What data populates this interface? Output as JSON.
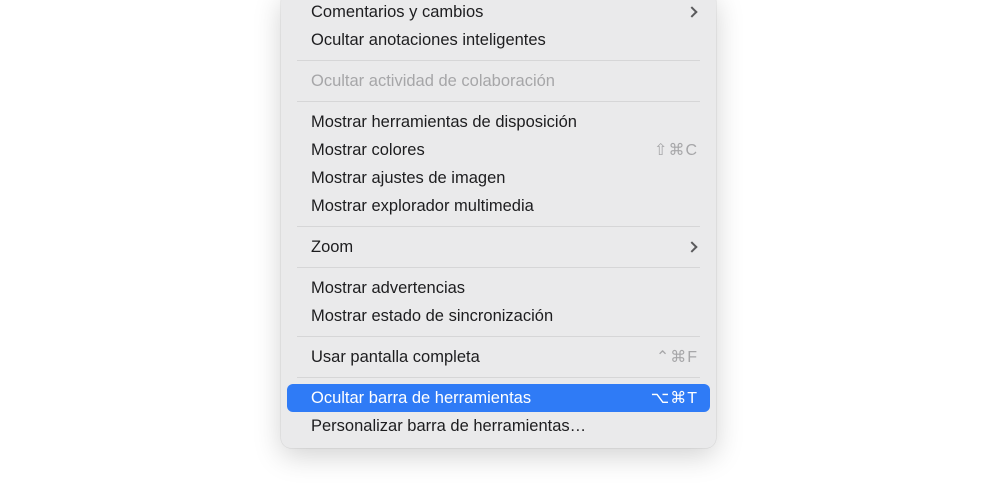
{
  "menu": {
    "items": [
      {
        "label": "Comentarios y cambios",
        "submenu": true
      },
      {
        "label": "Ocultar anotaciones inteligentes"
      },
      {
        "label": "Ocultar actividad de colaboración",
        "disabled": true
      },
      {
        "label": "Mostrar herramientas de disposición"
      },
      {
        "label": "Mostrar colores",
        "shortcut": "⇧⌘C"
      },
      {
        "label": "Mostrar ajustes de imagen"
      },
      {
        "label": "Mostrar explorador multimedia"
      },
      {
        "label": "Zoom",
        "submenu": true
      },
      {
        "label": "Mostrar advertencias"
      },
      {
        "label": "Mostrar estado de sincronización"
      },
      {
        "label": "Usar pantalla completa",
        "shortcut": "⌃⌘F"
      },
      {
        "label": "Ocultar barra de herramientas",
        "shortcut": "⌥⌘T",
        "highlighted": true
      },
      {
        "label": "Personalizar barra de herramientas…"
      }
    ]
  }
}
